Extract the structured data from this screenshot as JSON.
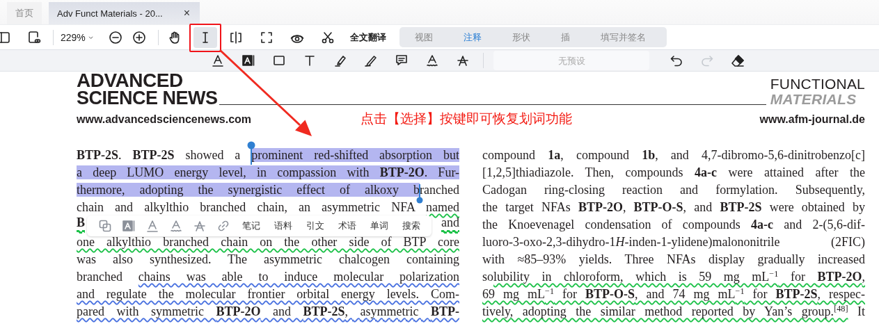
{
  "tabs": [
    {
      "label": "首页",
      "selected": false
    },
    {
      "label": "Adv Funct Materials - 20...",
      "selected": true,
      "close": "×"
    }
  ],
  "toolbar": {
    "zoom": "229%",
    "tools": [
      {
        "selected": false
      },
      {
        "selected": true
      },
      {
        "selected": false
      },
      {
        "selected": false
      },
      {
        "selected": false
      },
      {
        "selected": false
      }
    ],
    "translate": "全文翻译",
    "modes": [
      {
        "label": "视图",
        "selected": false
      },
      {
        "label": "注释",
        "selected": true
      },
      {
        "label": "形状",
        "selected": false
      },
      {
        "label": "插",
        "selected": false
      },
      {
        "label": "填写并签名",
        "selected": false
      }
    ]
  },
  "annotation_bar": {
    "preset_placeholder": "无预设",
    "redo_disabled": true
  },
  "document": {
    "header_left": {
      "title_top": "ADVANCED",
      "title": "SCIENCE NEWS",
      "url": "www.advancedsciencenews.com"
    },
    "header_right": {
      "title_top": "FUNCTIONAL",
      "title": "MATERIALS",
      "url": "www.afm-journal.de"
    },
    "callout": "点击【选择】按键即可恢复划词功能",
    "left_column": [
      {
        "kind": "text",
        "segments": [
          {
            "text": "**BTP-2S**. **BTP-2S** showed a ",
            "highlighted": false
          },
          {
            "text": "prominent red-shifted absorption but",
            "highlighted": true
          }
        ]
      },
      {
        "kind": "text",
        "segments": [
          {
            "text": "a deep LUMO energy level, in compassion with **BTP-2O**. Fur-",
            "highlighted": true
          }
        ]
      },
      {
        "kind": "text",
        "segments": [
          {
            "text": "thermore, adopting the synergistic effect of alkoxy b",
            "highlighted": true
          },
          {
            "text": "ranched",
            "highlighted": false
          }
        ]
      },
      {
        "kind": "text",
        "segments": [
          {
            "text": "chain and alkylthio branched chain, an asymmetric NFA ",
            "highlighted": false
          },
          {
            "text": "named",
            "highlighted": false,
            "color": "#1ec24a"
          }
        ]
      },
      {
        "kind": "covered",
        "segments": [
          {
            "text": "**B**",
            "highlighted": false,
            "color": "#1ec24a"
          },
          {
            "text": "and",
            "highlighted": false,
            "color": "#1ec24a"
          }
        ]
      },
      {
        "kind": "text",
        "segments": [
          {
            "text": "one alkylthio branched chain on the other side of BTP core",
            "highlighted": false,
            "color": "#1ec24a"
          }
        ]
      },
      {
        "kind": "text",
        "segments": [
          {
            "text": "was also synthesized. The asymmetric chalcogen containing",
            "highlighted": false
          }
        ]
      },
      {
        "kind": "text",
        "segments": [
          {
            "text": "branched ",
            "highlighted": false
          },
          {
            "text": "chains was able to induce molecular polarization",
            "highlighted": false,
            "color": "#4a72e0"
          }
        ]
      },
      {
        "kind": "text",
        "segments": [
          {
            "text": "and regulate the molecular frontier orbital energy levels. Com-",
            "highlighted": false,
            "color": "#4a72e0"
          }
        ]
      },
      {
        "kind": "text",
        "segments": [
          {
            "text": "pared with symmetric **BTP-2O** and **BTP-2S**, asymmetric **BTP-**",
            "highlighted": false,
            "color": "#4a72e0"
          }
        ]
      }
    ],
    "right_column": [
      {
        "kind": "text",
        "segments": [
          {
            "text": "compound **1a**, compound **1b**, and 4,7-dibromo-5,6-dinitrobenzo[c]",
            "highlighted": false
          }
        ]
      },
      {
        "kind": "text",
        "segments": [
          {
            "text": "[1,2,5]thiadiazole. Then, compounds **4a-c** were attained after the",
            "highlighted": false
          }
        ]
      },
      {
        "kind": "text",
        "segments": [
          {
            "text": "Cadogan ring-closing reaction and formylation. Subsequently,",
            "highlighted": false
          }
        ]
      },
      {
        "kind": "text",
        "segments": [
          {
            "text": "the target NFAs **BTP-2O**, **BTP-O-S**, and **BTP-2S** were obtained by",
            "highlighted": false
          }
        ]
      },
      {
        "kind": "text",
        "segments": [
          {
            "text": "the Knoevenagel condensation of compounds **4a-c** and 2-(5,6-dif-",
            "highlighted": false
          }
        ]
      },
      {
        "kind": "text",
        "segments": [
          {
            "text": "luoro-3-oxo-2,3-dihydro-1",
            "highlighted": false
          },
          {
            "text": "*H*",
            "highlighted": false
          },
          {
            "text": "-inden-1-ylidene)malononitrile (2FIC)",
            "highlighted": false
          }
        ]
      },
      {
        "kind": "text",
        "segments": [
          {
            "text": "with ≈85–93% yields. Three NFAs display gradually increased",
            "highlighted": false
          }
        ]
      },
      {
        "kind": "text",
        "segments": [
          {
            "text": "so",
            "highlighted": false
          },
          {
            "text": "lubility in chloroform, which is 59 mg mL$^{−1}$ for **BTP-2O**,",
            "highlighted": false,
            "color": "#1ec24a"
          }
        ]
      },
      {
        "kind": "text",
        "segments": [
          {
            "text": "69 mg mL$^{−1}$ for **BTP-O-S**, and 74 mg mL$^{−1}$ for **BTP-2S**, respec-",
            "highlighted": false,
            "color": "#1ec24a"
          }
        ]
      },
      {
        "kind": "text",
        "segments": [
          {
            "text": "tively, adopting the similar method reported by Yan’s group.$^{[48]}$",
            "highlighted": false,
            "color": "#1ec24a"
          },
          {
            "text": " It",
            "highlighted": false
          }
        ]
      }
    ]
  },
  "popup": {
    "actions": [
      "笔记",
      "语料",
      "引文",
      "术语",
      "单词",
      "搜索"
    ]
  }
}
